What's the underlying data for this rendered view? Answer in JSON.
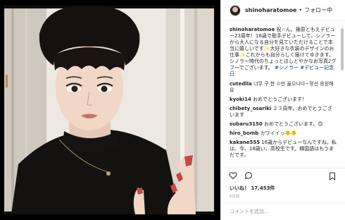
{
  "header": {
    "username": "shinoharatomoe",
    "dot": "•",
    "follow_label": "フォロー中"
  },
  "caption": {
    "user": "shinoharatomoe",
    "text": "祝☆ん。篠原ともえデビュー23周年！16歳で歌手デビューして、シノラーから大人になる自分を見ていただけることで本当に嬉しいです✨大好きな衣装のデザインのお仕事✨これからも自分らしく届けてゆきます。シノラー時代のちょっとほしとやかなお写真♪グフーでございます。",
    "hashtags": "#シノラー #デビュー記念日"
  },
  "comments": [
    {
      "user": "cutedlla",
      "text": "너무 구 한 ㅇ만 옳으니다~정선 응원해요"
    },
    {
      "user": "kyoki14",
      "text": "おめでとうございます！"
    },
    {
      "user": "chibety_osariki",
      "text": "２３周年。おめでとうございます"
    },
    {
      "user": "subaru3150",
      "text": "おめでとうございます。😊"
    },
    {
      "user": "hiro_bomb",
      "text": "カワイイっ🐥🐥"
    },
    {
      "user": "kakane555",
      "text": "16歳からデビューなんですね。私は、今、18歳い、高校生です。韓国語はもうまだです。"
    }
  ],
  "likes": {
    "label": "いいね！",
    "count": "17,453件"
  },
  "time": "6日前",
  "comment_box": {
    "placeholder": "コメントを追加..."
  },
  "icons": {
    "heart": "heart-icon",
    "comment": "comment-icon",
    "bookmark": "bookmark-icon"
  }
}
